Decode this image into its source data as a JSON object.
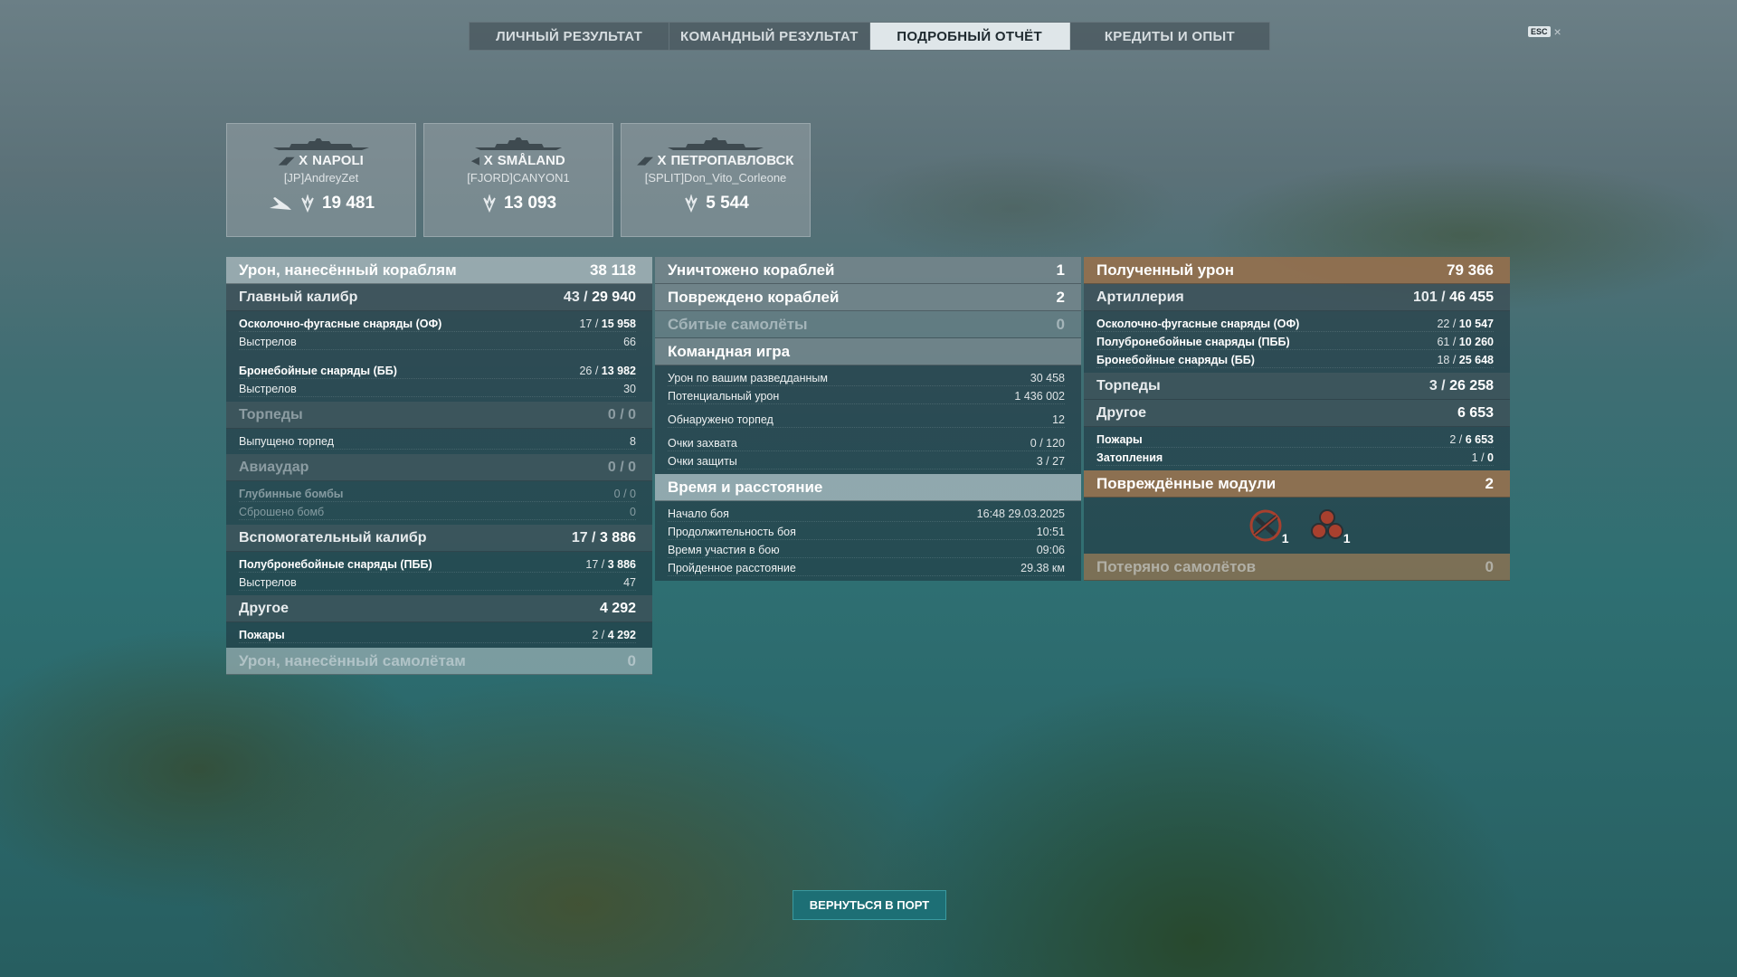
{
  "tabs": [
    "ЛИЧНЫЙ РЕЗУЛЬТАТ",
    "КОМАНДНЫЙ РЕЗУЛЬТАТ",
    "ПОДРОБНЫЙ ОТЧЁТ",
    "КРЕДИТЫ И ОПЫТ"
  ],
  "active_tab": "ПОДРОБНЫЙ ОТЧЁТ",
  "esc": {
    "key": "ESC",
    "close": "×"
  },
  "ships": [
    {
      "tier": "X",
      "name": "NAPOLI",
      "player": "[JP]AndreyZet",
      "score": "19 481",
      "icon": "carrier-icon"
    },
    {
      "tier": "X",
      "name": "SMÅLAND",
      "player": "[FJORD]CANYON1",
      "score": "13 093",
      "icon": "destroyer-icon"
    },
    {
      "tier": "X",
      "name": "ПЕТРОПАВЛОВСК",
      "player": "[SPLIT]Don_Vito_Corleone",
      "score": "5 544",
      "icon": "cruiser-icon"
    }
  ],
  "left": {
    "damage_ships": {
      "label": "Урон, нанесённый кораблям",
      "value": "38 118"
    },
    "main_caliber": {
      "label": "Главный калибр",
      "hits": "43",
      "value": "29 940"
    },
    "he_shells": {
      "label": "Осколочно-фугасные снаряды (ОФ)",
      "hits": "17",
      "value": "15 958"
    },
    "he_shots": {
      "label": "Выстрелов",
      "value": "66"
    },
    "ap_shells": {
      "label": "Бронебойные снаряды (ББ)",
      "hits": "26",
      "value": "13 982"
    },
    "ap_shots": {
      "label": "Выстрелов",
      "value": "30"
    },
    "torpedoes": {
      "label": "Торпеды",
      "value": "0 / 0"
    },
    "torp_launched": {
      "label": "Выпущено торпед",
      "value": "8"
    },
    "airstrike": {
      "label": "Авиаудар",
      "value": "0 / 0"
    },
    "depth_charges": {
      "label": "Глубинные бомбы",
      "value": "0 / 0"
    },
    "bombs_dropped": {
      "label": "Сброшено бомб",
      "value": "0"
    },
    "secondary": {
      "label": "Вспомогательный калибр",
      "hits": "17",
      "value": "3 886"
    },
    "sap_shells": {
      "label": "Полубронебойные снаряды (ПББ)",
      "hits": "17",
      "value": "3 886"
    },
    "sap_shots": {
      "label": "Выстрелов",
      "value": "47"
    },
    "other": {
      "label": "Другое",
      "value": "4 292"
    },
    "fires": {
      "label": "Пожары",
      "hits": "2",
      "value": "4 292"
    },
    "damage_planes": {
      "label": "Урон, нанесённый самолётам",
      "value": "0"
    }
  },
  "middle": {
    "destroyed": {
      "label": "Уничтожено кораблей",
      "value": "1"
    },
    "damaged": {
      "label": "Повреждено кораблей",
      "value": "2"
    },
    "planes_shot": {
      "label": "Сбитые самолёты",
      "value": "0"
    },
    "team_play": {
      "label": "Командная игра"
    },
    "spotting_damage": {
      "label": "Урон по вашим разведданным",
      "value": "30 458"
    },
    "potential_damage": {
      "label": "Потенциальный урон",
      "value": "1 436 002"
    },
    "torps_spotted": {
      "label": "Обнаружено торпед",
      "value": "12"
    },
    "capture_points": {
      "label": "Очки захвата",
      "value": "0 / 120"
    },
    "defense_points": {
      "label": "Очки защиты",
      "value": "3 / 27"
    },
    "time_distance": {
      "label": "Время и расстояние"
    },
    "battle_start": {
      "label": "Начало боя",
      "value": "16:48  29.03.2025"
    },
    "battle_duration": {
      "label": "Продолжительность боя",
      "value": "10:51"
    },
    "time_in_battle": {
      "label": "Время участия в бою",
      "value": "09:06"
    },
    "distance": {
      "label": "Пройденное расстояние",
      "value": "29.38 км"
    }
  },
  "right": {
    "received": {
      "label": "Полученный урон",
      "value": "79 366"
    },
    "artillery": {
      "label": "Артиллерия",
      "hits": "101",
      "value": "46 455"
    },
    "he_shells": {
      "label": "Осколочно-фугасные снаряды (ОФ)",
      "hits": "22",
      "value": "10 547"
    },
    "sap_shells": {
      "label": "Полубронебойные снаряды (ПББ)",
      "hits": "61",
      "value": "10 260"
    },
    "ap_shells": {
      "label": "Бронебойные снаряды (ББ)",
      "hits": "18",
      "value": "25 648"
    },
    "torpedoes": {
      "label": "Торпеды",
      "hits": "3",
      "value": "26 258"
    },
    "other": {
      "label": "Другое",
      "value": "6 653"
    },
    "fires": {
      "label": "Пожары",
      "hits": "2",
      "value": "6 653"
    },
    "flooding": {
      "label": "Затопления",
      "hits": "1",
      "value": "0"
    },
    "damaged_modules": {
      "label": "Повреждённые модули",
      "value": "2",
      "items": [
        {
          "icon": "gun-disabled-icon",
          "count": "1"
        },
        {
          "icon": "engine-cluster-icon",
          "count": "1"
        }
      ]
    },
    "planes_lost": {
      "label": "Потеряно самолётов",
      "value": "0"
    }
  },
  "port_button": "ВЕРНУТЬСЯ В ПОРТ",
  "colors": {
    "accent": "#1d6f75",
    "header_orange": "#96704e",
    "active_tab": "#dfe6e9"
  }
}
